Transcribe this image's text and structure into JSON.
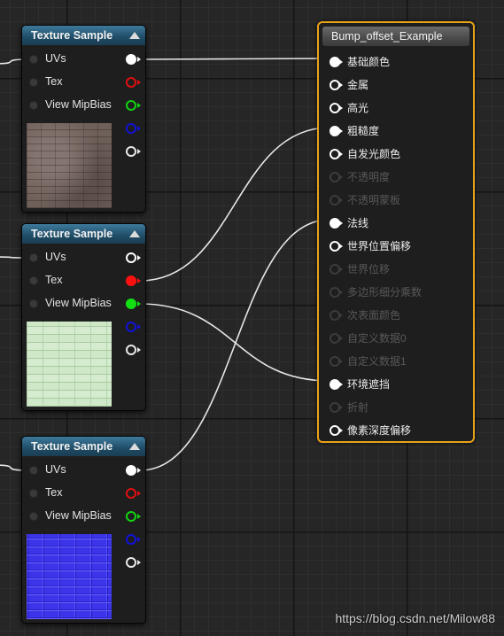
{
  "colors": {
    "node_header": "#1f4c66",
    "main_border": "#e8a21a",
    "wire": "#e6e6e6"
  },
  "texture_nodes": [
    {
      "title": "Texture Sample",
      "inputs": [
        "UVs",
        "Tex",
        "View MipBias"
      ],
      "outputs": [
        {
          "color": "#ffffff",
          "filled": true
        },
        {
          "color": "#e01010",
          "filled": false
        },
        {
          "color": "#12d312",
          "filled": false
        },
        {
          "color": "#1212d8",
          "filled": false
        },
        {
          "color": "#e8e8e8",
          "filled": false
        }
      ],
      "thumbnail": "brick-diffuse-texture"
    },
    {
      "title": "Texture Sample",
      "inputs": [
        "UVs",
        "Tex",
        "View MipBias"
      ],
      "outputs": [
        {
          "color": "#ffffff",
          "filled": false
        },
        {
          "color": "#ff1010",
          "filled": true
        },
        {
          "color": "#12e012",
          "filled": true
        },
        {
          "color": "#1212d8",
          "filled": false
        },
        {
          "color": "#e8e8e8",
          "filled": false
        }
      ],
      "thumbnail": "brick-heightmap-texture"
    },
    {
      "title": "Texture Sample",
      "inputs": [
        "UVs",
        "Tex",
        "View MipBias"
      ],
      "outputs": [
        {
          "color": "#ffffff",
          "filled": true
        },
        {
          "color": "#e01010",
          "filled": false
        },
        {
          "color": "#12d312",
          "filled": false
        },
        {
          "color": "#1212d8",
          "filled": false
        },
        {
          "color": "#e8e8e8",
          "filled": false
        }
      ],
      "thumbnail": "brick-normal-texture"
    }
  ],
  "main_node": {
    "title": "Bump_offset_Example",
    "pins": [
      {
        "label": "基础颜色",
        "connected": true,
        "enabled": true
      },
      {
        "label": "金属",
        "connected": false,
        "enabled": true
      },
      {
        "label": "高光",
        "connected": false,
        "enabled": true
      },
      {
        "label": "粗糙度",
        "connected": true,
        "enabled": true
      },
      {
        "label": "自发光颜色",
        "connected": false,
        "enabled": true
      },
      {
        "label": "不透明度",
        "connected": false,
        "enabled": false
      },
      {
        "label": "不透明蒙板",
        "connected": false,
        "enabled": false
      },
      {
        "label": "法线",
        "connected": true,
        "enabled": true
      },
      {
        "label": "世界位置偏移",
        "connected": false,
        "enabled": true
      },
      {
        "label": "世界位移",
        "connected": false,
        "enabled": false
      },
      {
        "label": "多边形细分乘数",
        "connected": false,
        "enabled": false
      },
      {
        "label": "次表面颜色",
        "connected": false,
        "enabled": false
      },
      {
        "label": "自定义数据0",
        "connected": false,
        "enabled": false
      },
      {
        "label": "自定义数据1",
        "connected": false,
        "enabled": false
      },
      {
        "label": "环境遮挡",
        "connected": true,
        "enabled": true
      },
      {
        "label": "折射",
        "connected": false,
        "enabled": false
      },
      {
        "label": "像素深度偏移",
        "connected": false,
        "enabled": true
      }
    ]
  },
  "watermark": "https://blog.csdn.net/Milow88"
}
